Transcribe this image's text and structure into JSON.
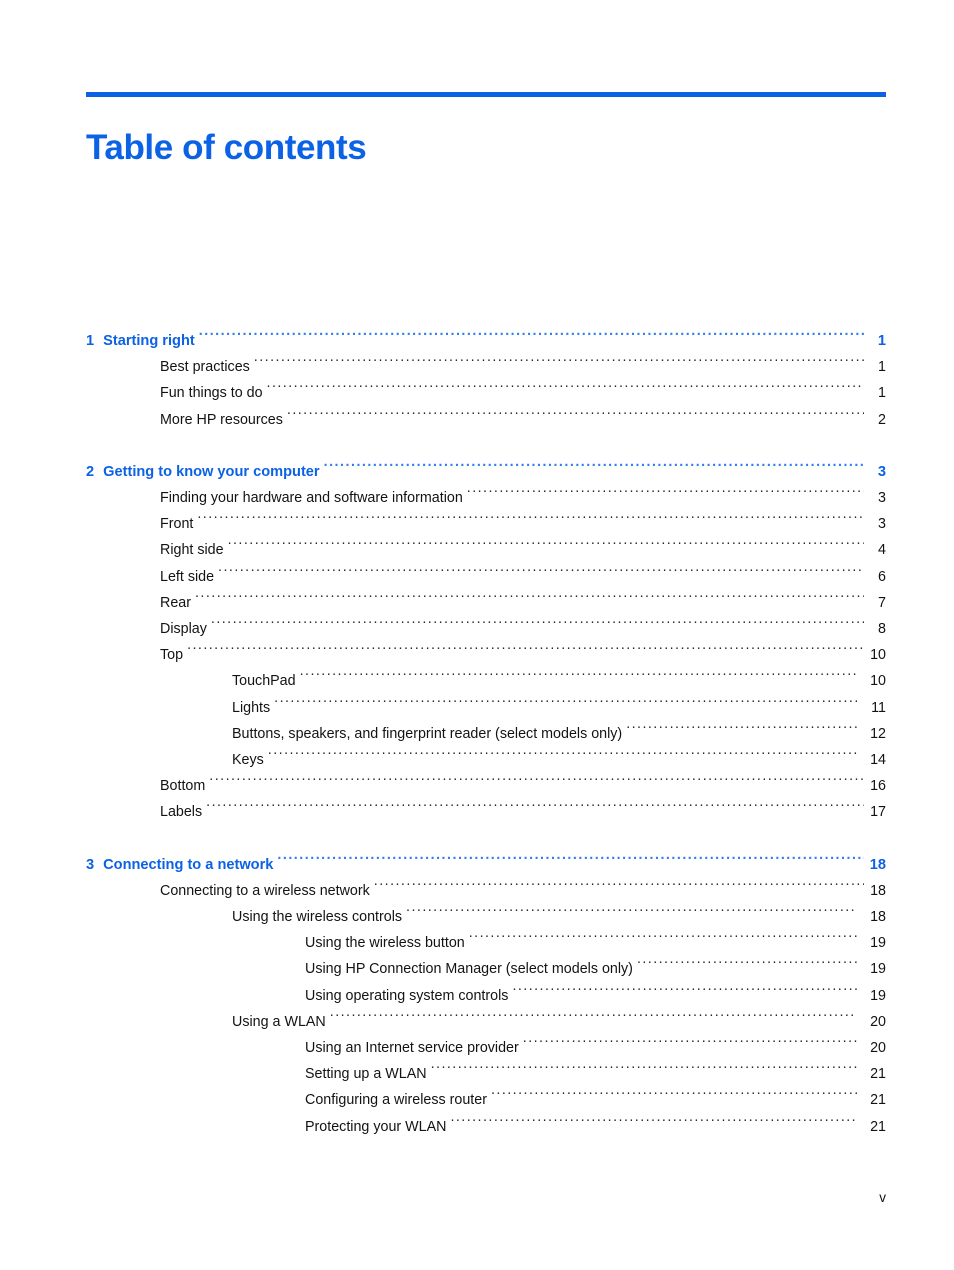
{
  "document": {
    "title": "Table of contents",
    "folio": "v",
    "accent_color": "#0b62e4",
    "text_color": "#131313"
  },
  "toc": {
    "chapters": [
      {
        "number": "1",
        "title": "Starting right",
        "page": "1",
        "entries": [
          {
            "level": 2,
            "label": "Best practices",
            "page": "1"
          },
          {
            "level": 2,
            "label": "Fun things to do",
            "page": "1"
          },
          {
            "level": 2,
            "label": "More HP resources",
            "page": "2"
          }
        ]
      },
      {
        "number": "2",
        "title": "Getting to know your computer",
        "page": "3",
        "entries": [
          {
            "level": 2,
            "label": "Finding your hardware and software information",
            "page": "3"
          },
          {
            "level": 2,
            "label": "Front",
            "page": "3"
          },
          {
            "level": 2,
            "label": "Right side",
            "page": "4"
          },
          {
            "level": 2,
            "label": "Left side",
            "page": "6"
          },
          {
            "level": 2,
            "label": "Rear",
            "page": "7"
          },
          {
            "level": 2,
            "label": "Display",
            "page": "8"
          },
          {
            "level": 2,
            "label": "Top",
            "page": "10"
          },
          {
            "level": 3,
            "label": "TouchPad",
            "page": "10"
          },
          {
            "level": 3,
            "label": "Lights",
            "page": "11"
          },
          {
            "level": 3,
            "label": "Buttons, speakers, and fingerprint reader (select models only)",
            "page": "12"
          },
          {
            "level": 3,
            "label": "Keys",
            "page": "14"
          },
          {
            "level": 2,
            "label": "Bottom",
            "page": "16"
          },
          {
            "level": 2,
            "label": "Labels",
            "page": "17"
          }
        ]
      },
      {
        "number": "3",
        "title": "Connecting to a network",
        "page": "18",
        "entries": [
          {
            "level": 2,
            "label": "Connecting to a wireless network",
            "page": "18"
          },
          {
            "level": 3,
            "label": "Using the wireless controls",
            "page": "18"
          },
          {
            "level": 4,
            "label": "Using the wireless button",
            "page": "19"
          },
          {
            "level": 4,
            "label": "Using HP Connection Manager (select models only)",
            "page": "19"
          },
          {
            "level": 4,
            "label": "Using operating system controls",
            "page": "19"
          },
          {
            "level": 3,
            "label": "Using a WLAN",
            "page": "20"
          },
          {
            "level": 4,
            "label": "Using an Internet service provider",
            "page": "20"
          },
          {
            "level": 4,
            "label": "Setting up a WLAN",
            "page": "21"
          },
          {
            "level": 4,
            "label": "Configuring a wireless router",
            "page": "21"
          },
          {
            "level": 4,
            "label": "Protecting your WLAN",
            "page": "21"
          }
        ]
      }
    ]
  }
}
